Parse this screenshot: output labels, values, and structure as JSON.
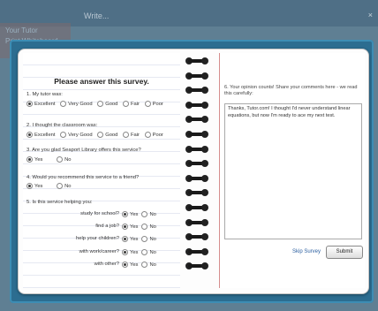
{
  "background": {
    "window_title": "Write...",
    "close_glyph": "×",
    "side_items": [
      "Your Tutor",
      "Print Whiteboard"
    ]
  },
  "survey": {
    "title": "Please answer this survey.",
    "questions": [
      {
        "text": "1. My tutor was:",
        "options": [
          "Excellent",
          "Very Good",
          "Good",
          "Fair",
          "Poor"
        ],
        "selected": "Excellent"
      },
      {
        "text": "2. I thought the classroom was:",
        "options": [
          "Excellent",
          "Very Good",
          "Good",
          "Fair",
          "Poor"
        ],
        "selected": "Excellent"
      },
      {
        "text": "3. Are you glad Seaport Library offers this service?",
        "options": [
          "Yes",
          "No"
        ],
        "selected": "Yes"
      },
      {
        "text": "4. Would you recommend this service to a friend?",
        "options": [
          "Yes",
          "No"
        ],
        "selected": "Yes"
      },
      {
        "text": "5. Is this service helping you:"
      }
    ],
    "sub_questions": [
      {
        "label": "study for school?",
        "selected": "Yes"
      },
      {
        "label": "find a job?",
        "selected": "Yes"
      },
      {
        "label": "help your children?",
        "selected": "Yes"
      },
      {
        "label": "with work/career?",
        "selected": "Yes"
      },
      {
        "label": "with other?",
        "selected": "Yes"
      }
    ],
    "yes_label": "Yes",
    "no_label": "No",
    "comment_prompt": "6. Your opinion counts! Share your comments here - we read this carefully:",
    "comment_value": "Thanks, Tutor.com! I thought I'd never understand linear equations, but now I'm ready to ace my next test.",
    "skip_label": "Skip Survey",
    "submit_label": "Submit"
  }
}
